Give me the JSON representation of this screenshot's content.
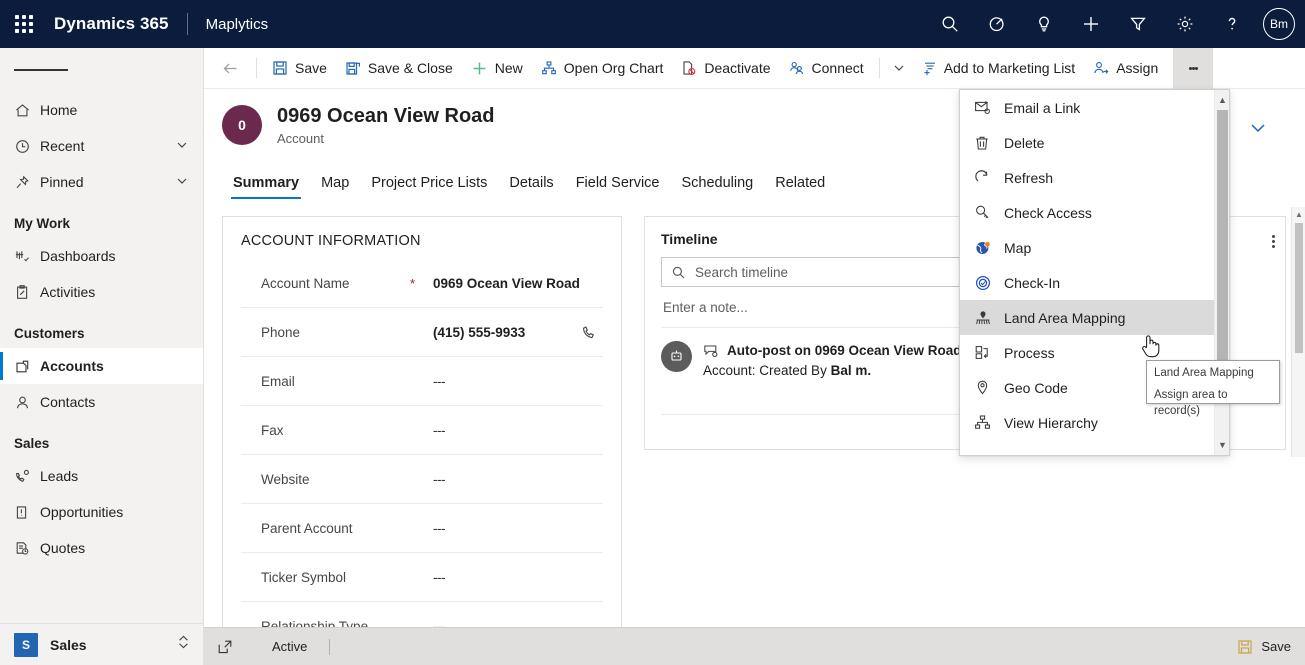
{
  "topnav": {
    "waffle_label": "app-launcher",
    "brand": "Dynamics 365",
    "app_name": "Maplytics",
    "icons": [
      "search-icon",
      "assistant-icon",
      "insights-icon",
      "quick-create-icon",
      "filter-icon",
      "settings-icon",
      "help-icon"
    ],
    "avatar_initials": "Bm"
  },
  "sidebar": {
    "items": [
      {
        "label": "Home",
        "icon": "home-icon",
        "expandable": false
      },
      {
        "label": "Recent",
        "icon": "clock-icon",
        "expandable": true
      },
      {
        "label": "Pinned",
        "icon": "pin-icon",
        "expandable": true
      }
    ],
    "groups": [
      {
        "title": "My Work",
        "items": [
          {
            "label": "Dashboards",
            "icon": "dashboard-icon"
          },
          {
            "label": "Activities",
            "icon": "activities-icon"
          }
        ]
      },
      {
        "title": "Customers",
        "items": [
          {
            "label": "Accounts",
            "icon": "accounts-icon",
            "active": true
          },
          {
            "label": "Contacts",
            "icon": "contacts-icon"
          }
        ]
      },
      {
        "title": "Sales",
        "items": [
          {
            "label": "Leads",
            "icon": "leads-icon"
          },
          {
            "label": "Opportunities",
            "icon": "opportunities-icon"
          },
          {
            "label": "Quotes",
            "icon": "quotes-icon"
          }
        ]
      }
    ],
    "area_switcher": {
      "badge": "S",
      "label": "Sales",
      "icon": "updown-chevron-icon"
    }
  },
  "commandbar": {
    "back_icon": "back-arrow-icon",
    "commands": [
      {
        "label": "Save",
        "icon": "save-icon"
      },
      {
        "label": "Save & Close",
        "icon": "save-and-close-icon"
      },
      {
        "label": "New",
        "icon": "plus-icon"
      },
      {
        "label": "Open Org Chart",
        "icon": "org-chart-icon"
      },
      {
        "label": "Deactivate",
        "icon": "deactivate-icon"
      },
      {
        "label": "Connect",
        "icon": "connect-icon"
      }
    ],
    "connect_caret": "chevron-down-icon",
    "commands_after": [
      {
        "label": "Add to Marketing List",
        "icon": "marketing-list-icon"
      },
      {
        "label": "Assign",
        "icon": "assign-icon"
      }
    ],
    "overflow_label": "More commands"
  },
  "record": {
    "avatar_initials": "0",
    "title": "0969 Ocean View Road",
    "subtitle": "Account",
    "header_chevron": "chevron-down-icon",
    "tabs": [
      {
        "label": "Summary",
        "active": true
      },
      {
        "label": "Map",
        "active": false
      },
      {
        "label": "Project Price Lists",
        "active": false
      },
      {
        "label": "Details",
        "active": false
      },
      {
        "label": "Field Service",
        "active": false
      },
      {
        "label": "Scheduling",
        "active": false
      },
      {
        "label": "Related",
        "active": false
      }
    ]
  },
  "account_information": {
    "section_title": "ACCOUNT INFORMATION",
    "fields": [
      {
        "label": "Account Name",
        "value": "0969 Ocean View Road",
        "required": true,
        "empty": false,
        "action_icon": ""
      },
      {
        "label": "Phone",
        "value": "(415) 555-9933",
        "required": false,
        "empty": false,
        "action_icon": "phone-icon"
      },
      {
        "label": "Email",
        "value": "---",
        "required": false,
        "empty": true,
        "action_icon": ""
      },
      {
        "label": "Fax",
        "value": "---",
        "required": false,
        "empty": true,
        "action_icon": ""
      },
      {
        "label": "Website",
        "value": "---",
        "required": false,
        "empty": true,
        "action_icon": ""
      },
      {
        "label": "Parent Account",
        "value": "---",
        "required": false,
        "empty": true,
        "action_icon": ""
      },
      {
        "label": "Ticker Symbol",
        "value": "---",
        "required": false,
        "empty": true,
        "action_icon": ""
      },
      {
        "label": "Relationship Type",
        "value": "---",
        "required": false,
        "empty": true,
        "action_icon": ""
      }
    ],
    "required_marker": "*"
  },
  "timeline": {
    "title": "Timeline",
    "search_placeholder": "Search timeline",
    "search_value": "",
    "note_placeholder": "Enter a note...",
    "post": {
      "line1": "Auto-post on 0969 Ocean View Road",
      "line2_prefix": "Account: Created By ",
      "line2_author": "Bal m."
    }
  },
  "third_panel": {
    "kebab_label": "more-options",
    "attachment_icon": "paperclip-icon"
  },
  "overflow_menu": {
    "items": [
      {
        "label": "Email a Link",
        "icon": "email-link-icon",
        "highlight": false
      },
      {
        "label": "Delete",
        "icon": "delete-icon",
        "highlight": false
      },
      {
        "label": "Refresh",
        "icon": "refresh-icon",
        "highlight": false
      },
      {
        "label": "Check Access",
        "icon": "check-access-icon",
        "highlight": false
      },
      {
        "label": "Map",
        "icon": "map-globe-icon",
        "highlight": false
      },
      {
        "label": "Check-In",
        "icon": "check-in-icon",
        "highlight": false
      },
      {
        "label": "Land Area Mapping",
        "icon": "land-area-mapping-icon",
        "highlight": true
      },
      {
        "label": "Process",
        "icon": "process-icon",
        "highlight": false
      },
      {
        "label": "Geo Code",
        "icon": "geo-code-icon",
        "highlight": false
      },
      {
        "label": "View Hierarchy",
        "icon": "view-hierarchy-icon",
        "highlight": false
      }
    ]
  },
  "tooltip": {
    "title": "Land Area Mapping",
    "description": "Assign area to record(s)"
  },
  "statusbar": {
    "popout_icon": "popout-icon",
    "status": "Active",
    "save_label": "Save",
    "save_icon": "save-icon"
  },
  "colors": {
    "nav_background": "#0b1c3d",
    "accent": "#0078d4",
    "record_avatar": "#6b2a4d",
    "required": "#a4262c",
    "menu_highlight": "#dadada",
    "sidebar_background": "#f3f2f1",
    "statusbar_background": "#e1dfdd"
  }
}
